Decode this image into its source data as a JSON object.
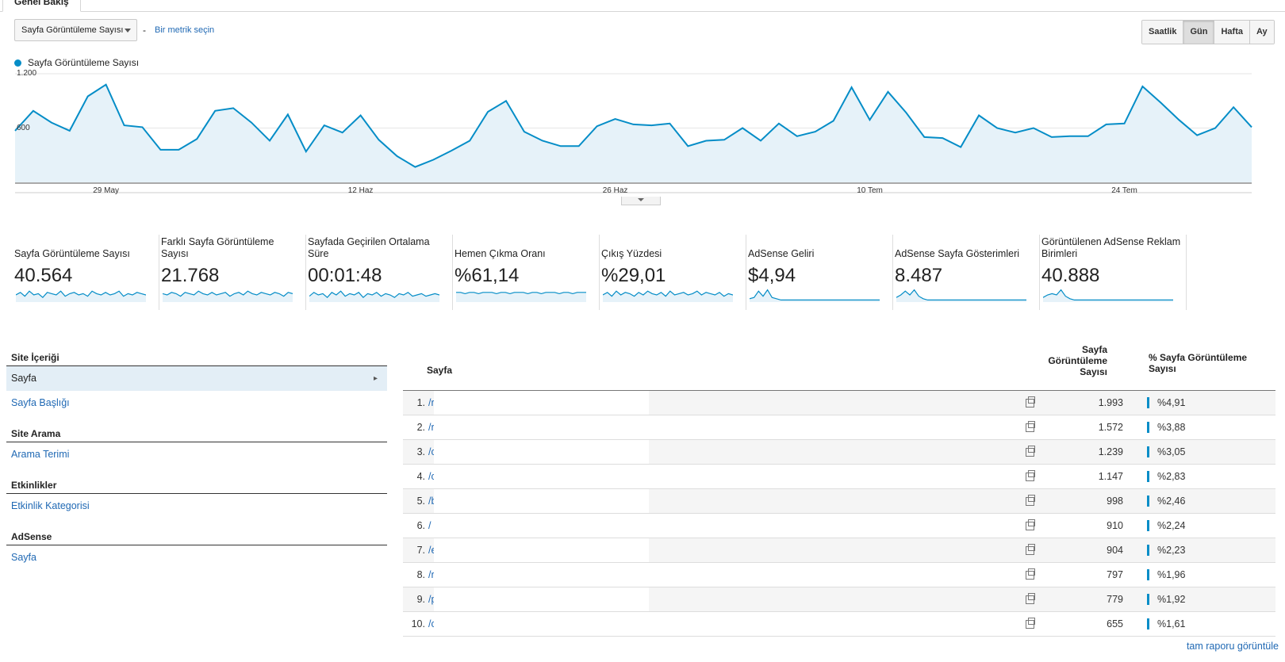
{
  "tab": {
    "label": "Genel Bakış"
  },
  "toolbar": {
    "metric_select": "Sayfa Görüntüleme Sayısı",
    "separator": "-",
    "pick_metric": "Bir metrik seçin",
    "periods": [
      "Saatlik",
      "Gün",
      "Hafta",
      "Ay"
    ],
    "active_period": "Gün"
  },
  "chart_data": {
    "type": "area",
    "series": [
      {
        "name": "Sayfa Görüntüleme Sayısı",
        "color": "#058dc7",
        "values": [
          570,
          790,
          660,
          570,
          950,
          1080,
          630,
          610,
          360,
          360,
          480,
          790,
          820,
          660,
          460,
          750,
          340,
          630,
          550,
          740,
          470,
          290,
          170,
          250,
          350,
          460,
          780,
          900,
          560,
          460,
          400,
          400,
          620,
          700,
          640,
          630,
          650,
          400,
          460,
          470,
          600,
          460,
          650,
          510,
          560,
          680,
          1050,
          690,
          1000,
          770,
          500,
          490,
          390,
          740,
          600,
          550,
          600,
          500,
          510,
          510,
          640,
          650,
          1060,
          880,
          690,
          520,
          600,
          830,
          610
        ]
      }
    ],
    "x_tick_labels": [
      "29 May",
      "12 Haz",
      "26 Haz",
      "10 Tem",
      "24 Tem"
    ],
    "y_tick_labels": [
      "1.200",
      "600"
    ],
    "ylim": [
      0,
      1200
    ]
  },
  "kpis": [
    {
      "label": "Sayfa Görüntüleme Sayısı",
      "value": "40.564"
    },
    {
      "label": "Farklı Sayfa Görüntüleme Sayısı",
      "value": "21.768"
    },
    {
      "label": "Sayfada Geçirilen Ortalama Süre",
      "value": "00:01:48"
    },
    {
      "label": "Hemen Çıkma Oranı",
      "value": "%61,14"
    },
    {
      "label": "Çıkış Yüzdesi",
      "value": "%29,01"
    },
    {
      "label": "AdSense Geliri",
      "value": "$4,94"
    },
    {
      "label": "AdSense Sayfa Gösterimleri",
      "value": "8.487"
    },
    {
      "label": "Görüntülenen AdSense Reklam Birimleri",
      "value": "40.888"
    }
  ],
  "nav": {
    "site_content": {
      "title": "Site İçeriği",
      "items": [
        "Sayfa",
        "Sayfa Başlığı"
      ]
    },
    "site_search": {
      "title": "Site Arama",
      "items": [
        "Arama Terimi"
      ]
    },
    "events": {
      "title": "Etkinlikler",
      "items": [
        "Etkinlik Kategorisi"
      ]
    },
    "adsense": {
      "title": "AdSense",
      "items": [
        "Sayfa"
      ]
    }
  },
  "table": {
    "col_page": "Sayfa",
    "col_views": "Sayfa Görüntüleme Sayısı",
    "col_pct": "% Sayfa Görüntüleme Sayısı",
    "rows": [
      {
        "rank": "1.",
        "page": "/r",
        "views": "1.993",
        "pct": "%4,91"
      },
      {
        "rank": "2.",
        "page": "/r",
        "views": "1.572",
        "pct": "%3,88"
      },
      {
        "rank": "3.",
        "page": "/c",
        "views": "1.239",
        "pct": "%3,05"
      },
      {
        "rank": "4.",
        "page": "/c",
        "views": "1.147",
        "pct": "%2,83"
      },
      {
        "rank": "5.",
        "page": "/b",
        "views": "998",
        "pct": "%2,46"
      },
      {
        "rank": "6.",
        "page": "/",
        "views": "910",
        "pct": "%2,24"
      },
      {
        "rank": "7.",
        "page": "/e",
        "views": "904",
        "pct": "%2,23"
      },
      {
        "rank": "8.",
        "page": "/r",
        "views": "797",
        "pct": "%1,96"
      },
      {
        "rank": "9.",
        "page": "/p",
        "views": "779",
        "pct": "%1,92"
      },
      {
        "rank": "10.",
        "page": "/c",
        "views": "655",
        "pct": "%1,61"
      }
    ],
    "full_report": "tam raporu görüntüle"
  }
}
